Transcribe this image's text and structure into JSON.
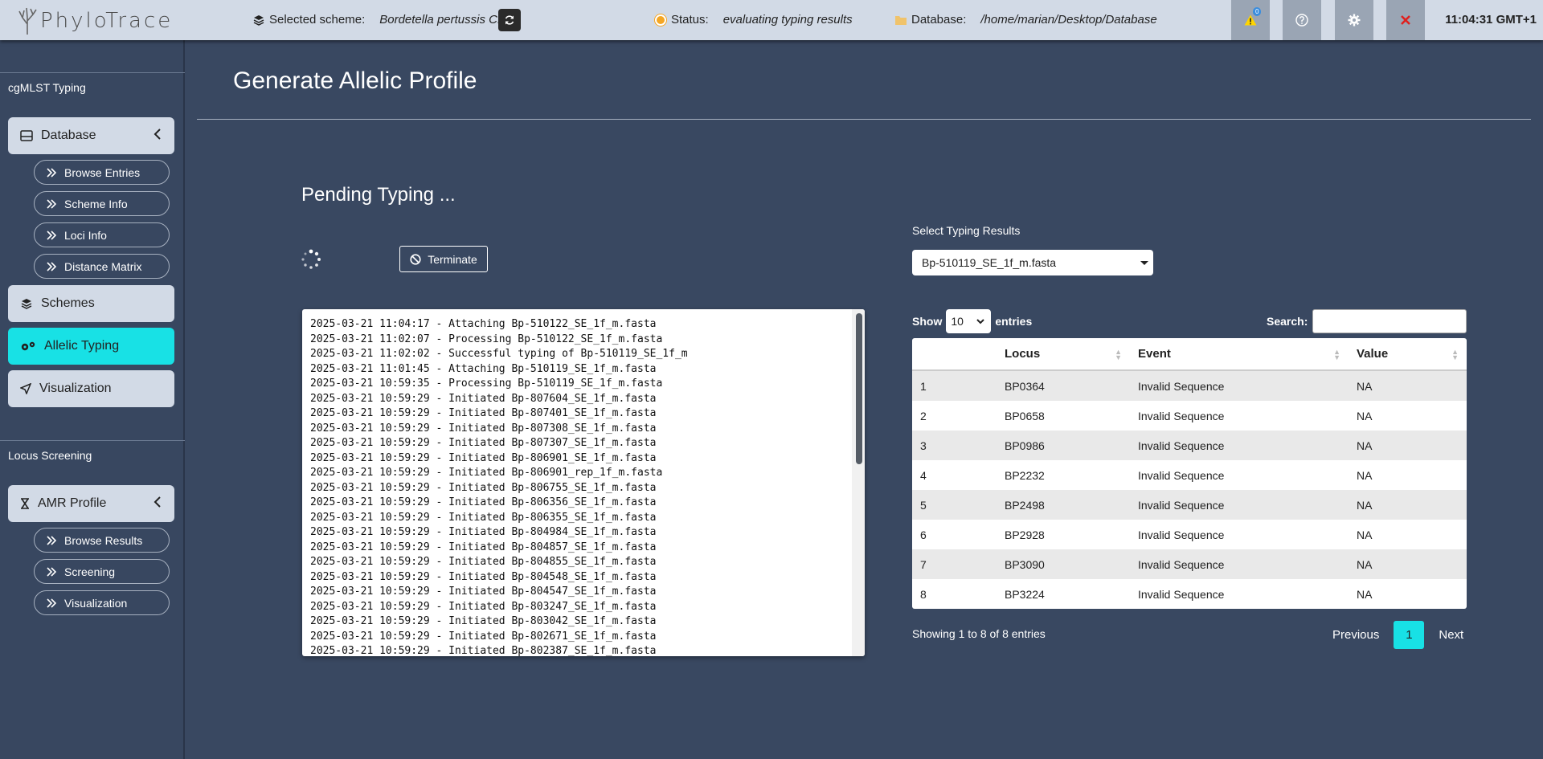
{
  "header": {
    "logo_text": "PhyloTrace",
    "scheme_label": "Selected scheme:",
    "scheme_value": "Bordetella pertussis CM",
    "status_label": "Status:",
    "status_value": "evaluating typing results",
    "database_label": "Database:",
    "database_value": "/home/marian/Desktop/Database",
    "alerts_count": "0",
    "clock": "11:04:31 GMT+1",
    "colors": {
      "header_bg": "#d2dae6",
      "status_dot": "#f5a623",
      "close_x": "#e0201e"
    }
  },
  "sidebar": {
    "section1_label": "cgMLST Typing",
    "database_label": "Database",
    "database_items": [
      "Browse Entries",
      "Scheme Info",
      "Loci Info",
      "Distance Matrix"
    ],
    "schemes_label": "Schemes",
    "allelic_typing_label": "Allelic Typing",
    "visualization_label": "Visualization",
    "section2_label": "Locus Screening",
    "amr_label": "AMR Profile",
    "amr_items": [
      "Browse Results",
      "Screening",
      "Visualization"
    ],
    "active_color": "#18e1e5"
  },
  "main": {
    "title": "Generate Allelic Profile",
    "pending_title": "Pending Typing ...",
    "terminate_label": "Terminate",
    "log_lines": [
      "2025-03-21 11:04:17 - Attaching Bp-510122_SE_1f_m.fasta",
      "2025-03-21 11:02:07 - Processing Bp-510122_SE_1f_m.fasta",
      "2025-03-21 11:02:02 - Successful typing of Bp-510119_SE_1f_m",
      "2025-03-21 11:01:45 - Attaching Bp-510119_SE_1f_m.fasta",
      "2025-03-21 10:59:35 - Processing Bp-510119_SE_1f_m.fasta",
      "2025-03-21 10:59:29 - Initiated Bp-807604_SE_1f_m.fasta",
      "2025-03-21 10:59:29 - Initiated Bp-807401_SE_1f_m.fasta",
      "2025-03-21 10:59:29 - Initiated Bp-807308_SE_1f_m.fasta",
      "2025-03-21 10:59:29 - Initiated Bp-807307_SE_1f_m.fasta",
      "2025-03-21 10:59:29 - Initiated Bp-806901_SE_1f_m.fasta",
      "2025-03-21 10:59:29 - Initiated Bp-806901_rep_1f_m.fasta",
      "2025-03-21 10:59:29 - Initiated Bp-806755_SE_1f_m.fasta",
      "2025-03-21 10:59:29 - Initiated Bp-806356_SE_1f_m.fasta",
      "2025-03-21 10:59:29 - Initiated Bp-806355_SE_1f_m.fasta",
      "2025-03-21 10:59:29 - Initiated Bp-804984_SE_1f_m.fasta",
      "2025-03-21 10:59:29 - Initiated Bp-804857_SE_1f_m.fasta",
      "2025-03-21 10:59:29 - Initiated Bp-804855_SE_1f_m.fasta",
      "2025-03-21 10:59:29 - Initiated Bp-804548_SE_1f_m.fasta",
      "2025-03-21 10:59:29 - Initiated Bp-804547_SE_1f_m.fasta",
      "2025-03-21 10:59:29 - Initiated Bp-803247_SE_1f_m.fasta",
      "2025-03-21 10:59:29 - Initiated Bp-803042_SE_1f_m.fasta",
      "2025-03-21 10:59:29 - Initiated Bp-802671_SE_1f_m.fasta",
      "2025-03-21 10:59:29 - Initiated Bp-802387_SE_1f_m.fasta"
    ],
    "select_label": "Select Typing Results",
    "select_value": "Bp-510119_SE_1f_m.fasta",
    "show_label": "Show",
    "show_value": "10",
    "entries_label": "entries",
    "search_label": "Search:",
    "search_value": "",
    "columns": [
      "",
      "Locus",
      "Event",
      "Value"
    ],
    "rows": [
      [
        "1",
        "BP0364",
        "Invalid Sequence",
        "NA"
      ],
      [
        "2",
        "BP0658",
        "Invalid Sequence",
        "NA"
      ],
      [
        "3",
        "BP0986",
        "Invalid Sequence",
        "NA"
      ],
      [
        "4",
        "BP2232",
        "Invalid Sequence",
        "NA"
      ],
      [
        "5",
        "BP2498",
        "Invalid Sequence",
        "NA"
      ],
      [
        "6",
        "BP2928",
        "Invalid Sequence",
        "NA"
      ],
      [
        "7",
        "BP3090",
        "Invalid Sequence",
        "NA"
      ],
      [
        "8",
        "BP3224",
        "Invalid Sequence",
        "NA"
      ]
    ],
    "table_info": "Showing 1 to 8 of 8 entries",
    "pager_prev": "Previous",
    "pager_current": "1",
    "pager_next": "Next"
  }
}
